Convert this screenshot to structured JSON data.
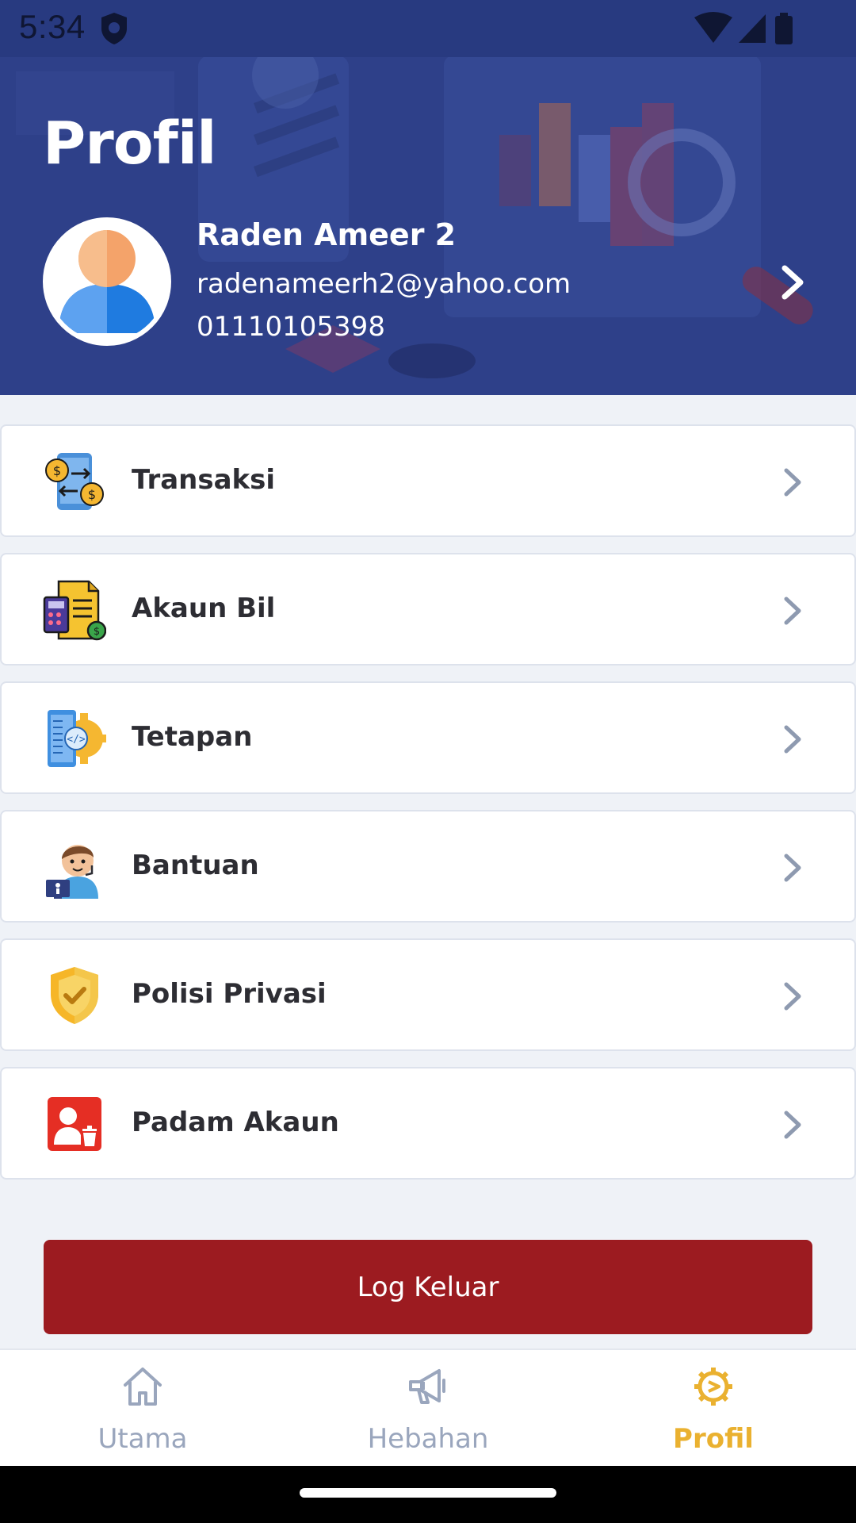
{
  "status_bar": {
    "time": "5:34"
  },
  "header": {
    "title": "Profil"
  },
  "user": {
    "name": "Raden Ameer 2",
    "email": "radenameerh2@yahoo.com",
    "phone": "01110105398"
  },
  "menu": {
    "items": [
      {
        "label": "Transaksi",
        "icon": "transaction-icon"
      },
      {
        "label": "Akaun Bil",
        "icon": "bill-account-icon"
      },
      {
        "label": "Tetapan",
        "icon": "settings-icon"
      },
      {
        "label": "Bantuan",
        "icon": "support-icon"
      },
      {
        "label": "Polisi Privasi",
        "icon": "privacy-shield-icon"
      },
      {
        "label": "Padam Akaun",
        "icon": "delete-account-icon"
      }
    ]
  },
  "logout": {
    "label": "Log Keluar"
  },
  "nav": {
    "items": [
      {
        "label": "Utama",
        "icon": "home-icon",
        "active": false
      },
      {
        "label": "Hebahan",
        "icon": "megaphone-icon",
        "active": false
      },
      {
        "label": "Profil",
        "icon": "profile-gear-icon",
        "active": true
      }
    ]
  },
  "colors": {
    "header_bg": "#2e4089",
    "logout_bg": "#9c1b20",
    "active_nav": "#eab130",
    "inactive_nav": "#9aa6bd"
  }
}
